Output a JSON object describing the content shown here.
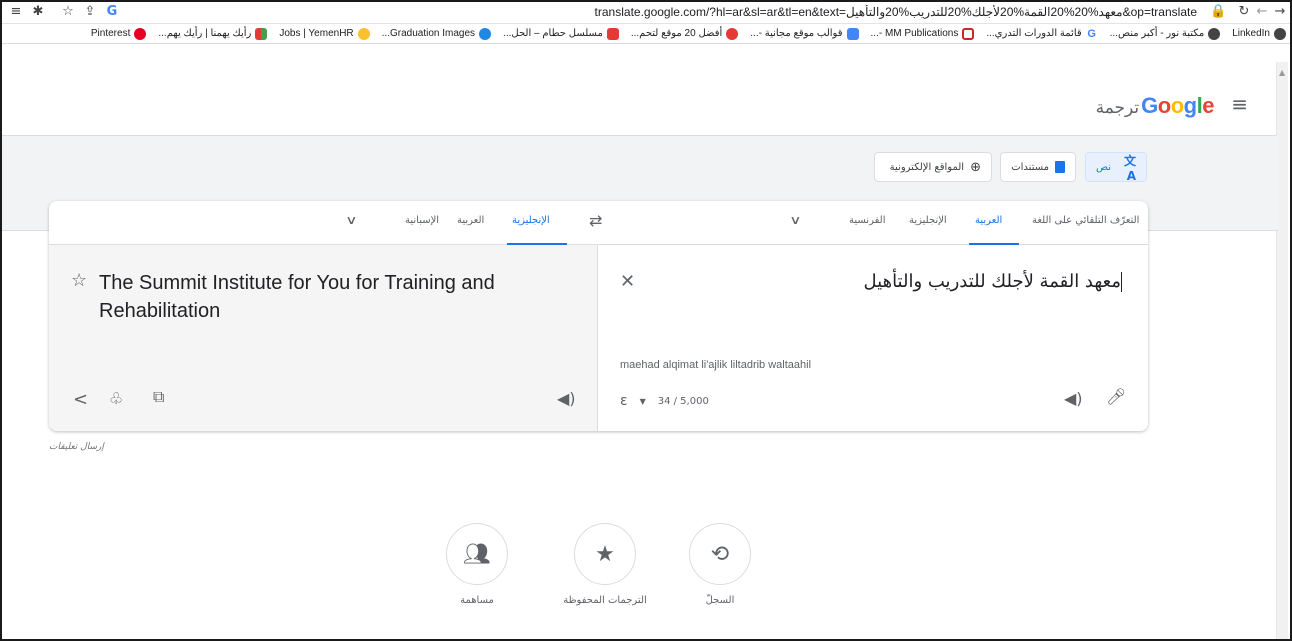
{
  "browser": {
    "url": "translate.google.com/?hl=ar&sl=ar&tl=en&text=معهد%20%20القمة%20لأجلك%20للتدريب%20والتأهيل&op=translate",
    "bookmarks": [
      "LinkedIn",
      "مكتبة نور - أكبر منص...",
      "قائمة الدورات التدري...",
      "MM Publications -...",
      "قوالب موقع مجانية -...",
      "أفضل 20 موقع لتحم...",
      "مسلسل حطام – الحل...",
      "Graduation Images...",
      "Jobs | YemenHR",
      "رأيك يهمنا | رأيك يهم...",
      "Pinterest"
    ]
  },
  "header": {
    "logo_text": "Google",
    "product": "ترجمة"
  },
  "modes": {
    "text": "نص",
    "documents": "مستندات",
    "websites": "المواقع الإلكترونية"
  },
  "source": {
    "languages": [
      "التعرّف التلقائي على اللغة",
      "العربية",
      "الإنجليزية",
      "الفرنسية"
    ],
    "text": "معهد  القمة لأجلك للتدريب والتأهيل",
    "transliteration": "maehad alqimat li'ajlik liltadrib waltaahil",
    "counter": "34 / 5,000"
  },
  "target": {
    "languages": [
      "الإنجليزية",
      "العربية",
      "الإسبانية"
    ],
    "text": "The Summit Institute for You for Training and Rehabilitation"
  },
  "feedback": "إرسال تعليقات",
  "bottom": {
    "history": "السجلّ",
    "saved": "الترجمات المحفوظة",
    "contribute": "مساهمة"
  },
  "colors": {
    "google_blue": "#4285F4",
    "google_red": "#EA4335",
    "google_yellow": "#FBBC05",
    "google_green": "#34A853",
    "accent": "#1a73e8"
  }
}
